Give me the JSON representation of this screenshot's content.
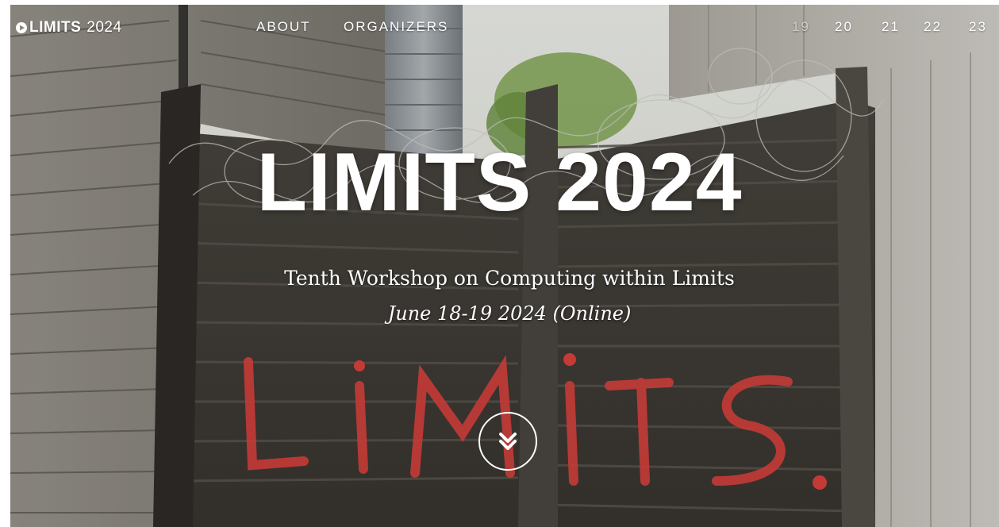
{
  "nav": {
    "brand_bold": "LIMITS",
    "brand_year": "2024",
    "links": [
      {
        "label": "ABOUT"
      },
      {
        "label": "ORGANIZERS"
      },
      {
        "label": "19"
      },
      {
        "label": "20"
      },
      {
        "label": "21"
      },
      {
        "label": "22"
      },
      {
        "label": "23"
      }
    ]
  },
  "hero": {
    "title": "LIMITS 2024",
    "subtitle": "Tenth Workshop on Computing within Limits",
    "dates": "June 18-19 2024 (Online)",
    "scroll_icon": "double-chevron-down-icon"
  },
  "colors": {
    "text": "#ffffff",
    "graffiti": "#e0433e"
  }
}
